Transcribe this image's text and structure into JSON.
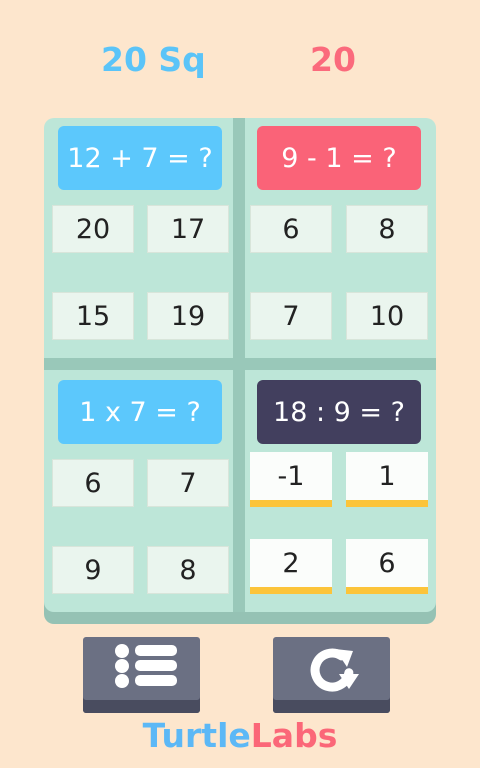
{
  "score": {
    "left": "20 Sq",
    "right": "20"
  },
  "panels": {
    "top_left": {
      "question": "12 + 7 = ?",
      "answers": [
        "20",
        "17",
        "15",
        "19"
      ]
    },
    "top_right": {
      "question": "9 - 1 = ?",
      "answers": [
        "6",
        "8",
        "7",
        "10"
      ]
    },
    "bottom_left": {
      "question": "1 x 7 = ?",
      "answers": [
        "6",
        "7",
        "9",
        "8"
      ]
    },
    "bottom_right": {
      "question": "18 : 9 = ?",
      "answers": [
        "-1",
        "1",
        "2",
        "6"
      ]
    }
  },
  "buttons": {
    "menu_icon": "list-icon",
    "restart_icon": "restart-icon"
  },
  "brand": {
    "part1": "Turtle",
    "part2": "Labs"
  },
  "colors": {
    "background": "#fde6cd",
    "board": "#bde6d8",
    "blue": "#5cc8fc",
    "red": "#fa6378",
    "dark": "#423f5e",
    "accent_yellow": "#fcc43a"
  }
}
